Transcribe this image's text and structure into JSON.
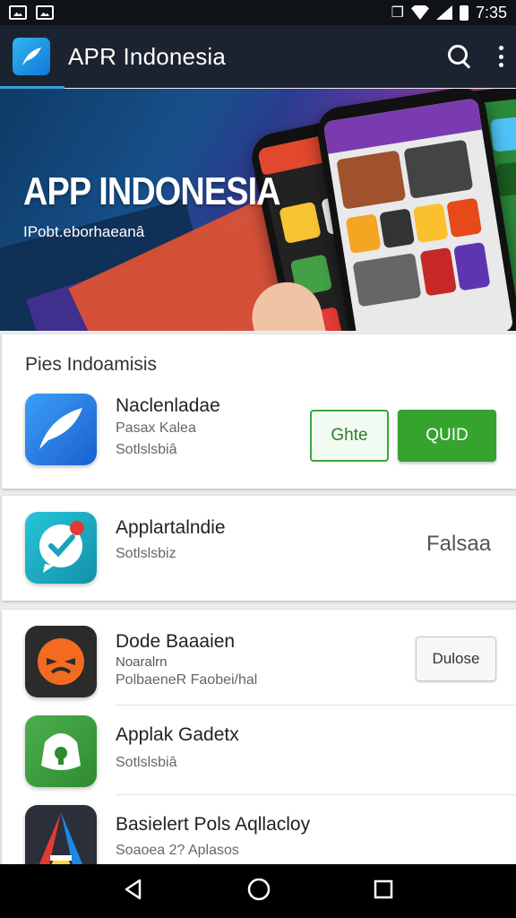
{
  "status_bar": {
    "time": "7:35",
    "icons": [
      "image-icon",
      "image-icon",
      "vibrate-icon",
      "wifi-icon",
      "signal-icon",
      "battery-icon"
    ]
  },
  "app_bar": {
    "title": "APR Indonesia",
    "icons": [
      "app-logo-icon",
      "search-icon",
      "more-vert-icon"
    ]
  },
  "banner": {
    "title": "APP INDONESIA",
    "subtitle": "IPobt.eborhaeanâ"
  },
  "section": {
    "title": "Pies Indoamisis"
  },
  "apps": [
    {
      "name": "Naclenladae",
      "meta1": "Pasax  Kalea",
      "meta2": "Sotlslsbiâ",
      "icon": "feather-icon",
      "buttons": [
        "Ghte",
        "QUID"
      ]
    },
    {
      "name": "Applartalndie",
      "meta1": "Sotlslsbiz",
      "icon": "chat-check-icon",
      "status": "Falsaa"
    },
    {
      "name": "Dode Baaaien",
      "meta1": "Noaralrn",
      "meta2": "PolbaeneR Faobei/hal",
      "icon": "face-icon",
      "button": "Dulose"
    },
    {
      "name": "Applak Gadetx",
      "meta1": "Sotlslsbiâ",
      "icon": "android-lock-icon"
    },
    {
      "name": "Basielert Pols Aqllacloy",
      "meta1": "Soaoea 2? Aplasos",
      "icon": "letter-a-icon"
    }
  ],
  "nav_bar": {
    "icons": [
      "back-icon",
      "home-icon",
      "recents-icon"
    ]
  },
  "colors": {
    "app_bar": "#1c2330",
    "accent_green": "#34a42f",
    "accent_blue": "#3a9ddf"
  }
}
